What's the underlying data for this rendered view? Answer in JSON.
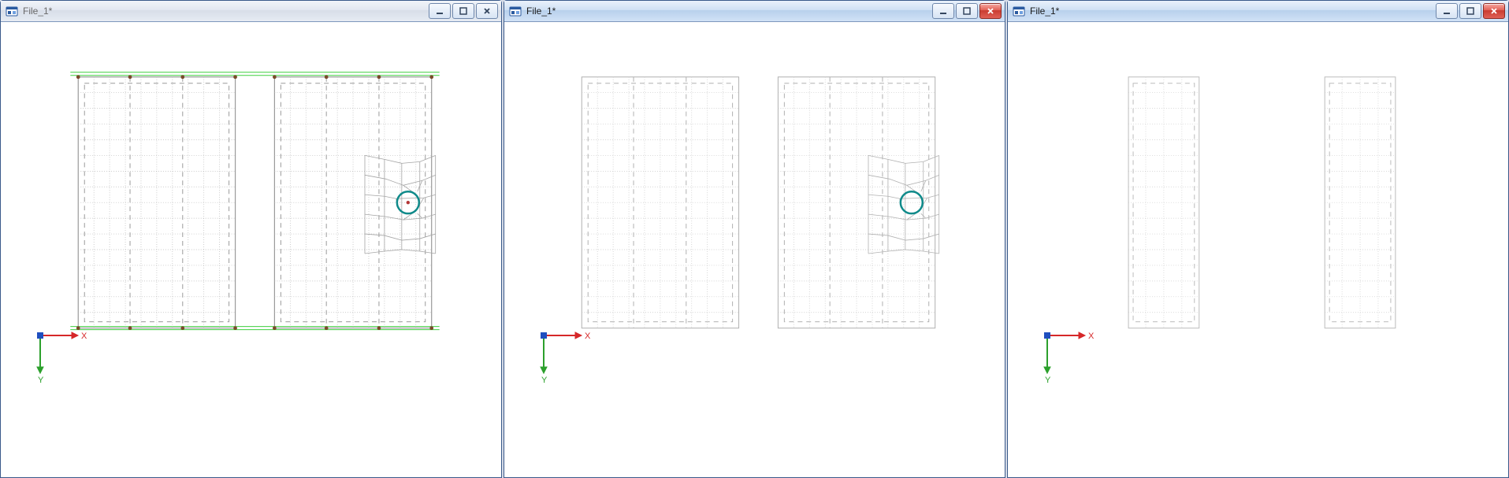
{
  "windows": [
    {
      "id": "w1",
      "title": "File_1*",
      "active": false,
      "close_style": "normal"
    },
    {
      "id": "w2",
      "title": "File_1*",
      "active": true,
      "close_style": "red"
    },
    {
      "id": "w3",
      "title": "File_1*",
      "active": true,
      "close_style": "red"
    }
  ],
  "axis_labels": {
    "x": "X",
    "y": "Y"
  },
  "icons": {
    "app": "app-icon",
    "minimize": "minimize-icon",
    "maximize": "maximize-icon",
    "close": "close-icon"
  }
}
